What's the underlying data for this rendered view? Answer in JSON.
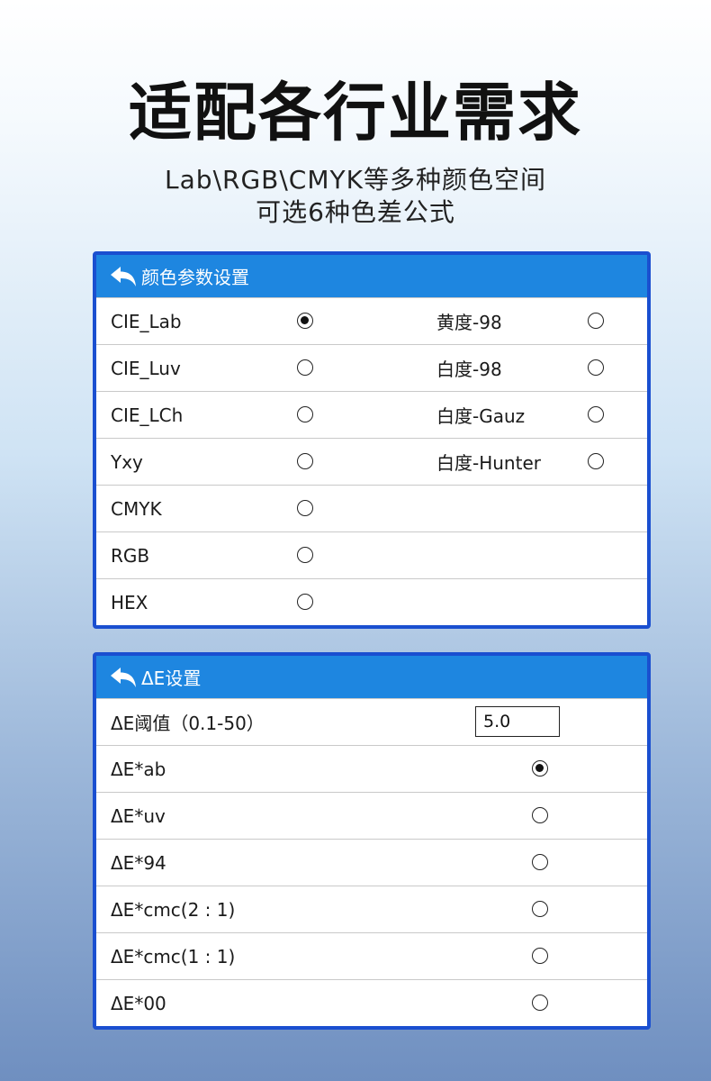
{
  "headline": "适配各行业需求",
  "subtitle_line1": "Lab\\RGB\\CMYK等多种颜色空间",
  "subtitle_line2": "可选6种色差公式",
  "color_panel": {
    "title": "颜色参数设置",
    "back_icon": "back-arrow-icon",
    "rows": [
      {
        "left_label": "CIE_Lab",
        "left_checked": true,
        "right_label": "黄度-98",
        "right_checked": false
      },
      {
        "left_label": "CIE_Luv",
        "left_checked": false,
        "right_label": "白度-98",
        "right_checked": false
      },
      {
        "left_label": "CIE_LCh",
        "left_checked": false,
        "right_label": "白度-Gauz",
        "right_checked": false
      },
      {
        "left_label": "Yxy",
        "left_checked": false,
        "right_label": "白度-Hunter",
        "right_checked": false
      },
      {
        "left_label": "CMYK",
        "left_checked": false
      },
      {
        "left_label": "RGB",
        "left_checked": false
      },
      {
        "left_label": "HEX",
        "left_checked": false
      }
    ]
  },
  "de_panel": {
    "title": "ΔE设置",
    "back_icon": "back-arrow-icon",
    "threshold_label": "ΔE阈值（0.1-50）",
    "threshold_value": "5.0",
    "rows": [
      {
        "label": "ΔE*ab",
        "checked": true
      },
      {
        "label": "ΔE*uv",
        "checked": false
      },
      {
        "label": "ΔE*94",
        "checked": false
      },
      {
        "label": "ΔE*cmc(2 : 1)",
        "checked": false
      },
      {
        "label": "ΔE*cmc(1 : 1)",
        "checked": false
      },
      {
        "label": "ΔE*00",
        "checked": false
      }
    ]
  },
  "colors": {
    "panel_border": "#1a4fd0",
    "header_bg": "#1e86e0"
  }
}
